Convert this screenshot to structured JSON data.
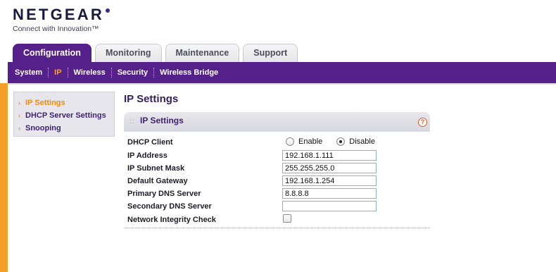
{
  "brand": {
    "name": "NETGEAR",
    "tagline": "Connect with Innovation™"
  },
  "tabs": [
    {
      "label": "Configuration",
      "active": true
    },
    {
      "label": "Monitoring",
      "active": false
    },
    {
      "label": "Maintenance",
      "active": false
    },
    {
      "label": "Support",
      "active": false
    }
  ],
  "subnav": [
    {
      "label": "System",
      "active": false
    },
    {
      "label": "IP",
      "active": true
    },
    {
      "label": "Wireless",
      "active": false
    },
    {
      "label": "Security",
      "active": false
    },
    {
      "label": "Wireless Bridge",
      "active": false
    }
  ],
  "sidebar": {
    "items": [
      {
        "label": "IP Settings",
        "active": true
      },
      {
        "label": "DHCP Server Settings",
        "active": false
      },
      {
        "label": "Snooping",
        "active": false
      }
    ]
  },
  "main": {
    "title": "IP Settings",
    "panel_title": "IP Settings",
    "help_glyph": "?"
  },
  "form": {
    "dhcp_label": "DHCP Client",
    "dhcp_enable": "Enable",
    "dhcp_disable": "Disable",
    "dhcp_selected": "Disable",
    "ip_address_label": "IP Address",
    "ip_address": "192.168.1.111",
    "subnet_label": "IP Subnet Mask",
    "subnet": "255.255.255.0",
    "gateway_label": "Default Gateway",
    "gateway": "192.168.1.254",
    "primary_dns_label": "Primary DNS Server",
    "primary_dns": "8.8.8.8",
    "secondary_dns_label": "Secondary DNS Server",
    "secondary_dns": "",
    "integrity_label": "Network Integrity Check",
    "integrity_checked": false
  },
  "colors": {
    "brand_purple": "#56208b",
    "accent_orange": "#f2a028",
    "active_link": "#ff9f2a"
  }
}
